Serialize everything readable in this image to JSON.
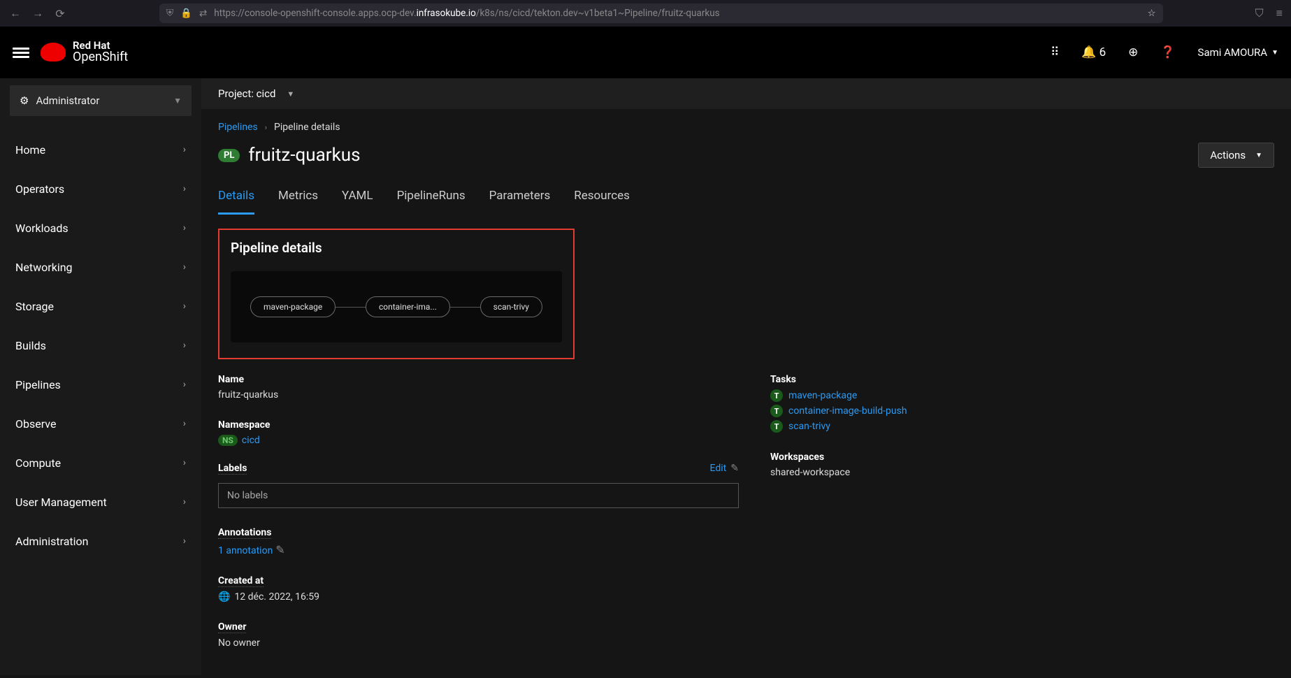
{
  "browser": {
    "url_prefix": "https://console-openshift-console.apps.ocp-dev.",
    "url_bold": "infrasokube.io",
    "url_suffix": "/k8s/ns/cicd/tekton.dev~v1beta1~Pipeline/fruitz-quarkus"
  },
  "brand": {
    "line1": "Red Hat",
    "line2": "OpenShift"
  },
  "header": {
    "notifications": "6",
    "user": "Sami AMOURA"
  },
  "sidebar": {
    "perspective": "Administrator",
    "items": [
      "Home",
      "Operators",
      "Workloads",
      "Networking",
      "Storage",
      "Builds",
      "Pipelines",
      "Observe",
      "Compute",
      "User Management",
      "Administration"
    ]
  },
  "project_bar": {
    "label": "Project: cicd"
  },
  "breadcrumb": {
    "link": "Pipelines",
    "current": "Pipeline details"
  },
  "title": {
    "badge": "PL",
    "text": "fruitz-quarkus"
  },
  "actions": {
    "label": "Actions"
  },
  "tabs": [
    "Details",
    "Metrics",
    "YAML",
    "PipelineRuns",
    "Parameters",
    "Resources"
  ],
  "pipe_box": {
    "heading": "Pipeline details",
    "tasks": [
      "maven-package",
      "container-ima...",
      "scan-trivy"
    ]
  },
  "details": {
    "name_label": "Name",
    "name_value": "fruitz-quarkus",
    "namespace_label": "Namespace",
    "namespace_badge": "NS",
    "namespace_value": "cicd",
    "labels_label": "Labels",
    "labels_edit": "Edit",
    "labels_value": "No labels",
    "annotations_label": "Annotations",
    "annotations_value": "1 annotation",
    "created_label": "Created at",
    "created_value": "12 déc. 2022, 16:59",
    "owner_label": "Owner",
    "owner_value": "No owner",
    "tasks_label": "Tasks",
    "tasks": [
      "maven-package",
      "container-image-build-push",
      "scan-trivy"
    ],
    "workspaces_label": "Workspaces",
    "workspaces_value": "shared-workspace"
  }
}
